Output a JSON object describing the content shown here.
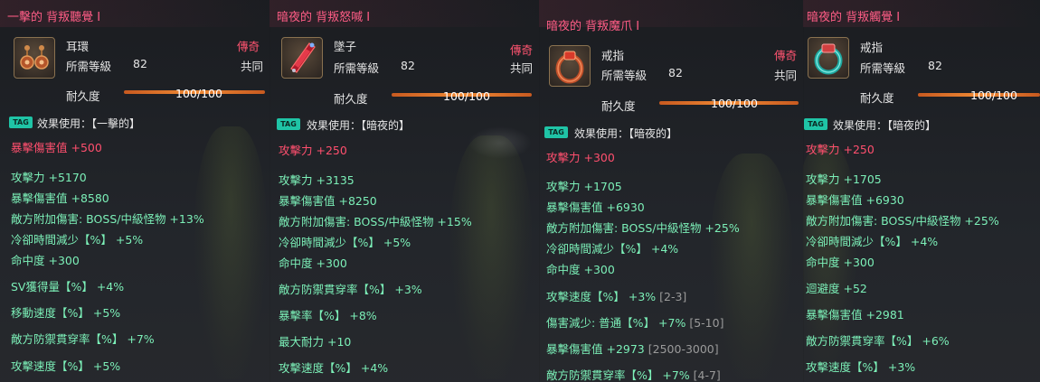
{
  "panels": [
    {
      "title": "一擊的 背叛聽覺 I",
      "type": "耳環",
      "level_label": "所需等級",
      "level": "82",
      "rarity": "傳奇",
      "shared": "共同",
      "durability_label": "耐久度",
      "durability": "100/100",
      "tag": "TAG",
      "effect": "效果使用：【一擊的】",
      "icon": "earring-icon",
      "highlight": "暴擊傷害值 +500",
      "stats": [
        {
          "name": "攻擊力 +5170"
        },
        {
          "name": "暴擊傷害值 +8580"
        },
        {
          "name": "敵方附加傷害: BOSS/中級怪物 +13%"
        },
        {
          "name": "冷卻時間減少【%】 +5%"
        },
        {
          "name": "命中度 +300"
        },
        {
          "name": "SV獲得量【%】 +4%"
        },
        {
          "name": "移動速度【%】 +5%"
        },
        {
          "name": "敵方防禦貫穿率【%】 +7%"
        },
        {
          "name": "攻擊速度【%】 +5%"
        }
      ]
    },
    {
      "title": "暗夜的 背叛怒喊 I",
      "type": "墜子",
      "level_label": "所需等級",
      "level": "82",
      "rarity": "傳奇",
      "shared": "共同",
      "durability_label": "耐久度",
      "durability": "100/100",
      "tag": "TAG",
      "effect": "效果使用：【暗夜的】",
      "icon": "pendant-icon",
      "highlight": "攻擊力 +250",
      "stats": [
        {
          "name": "攻擊力 +3135"
        },
        {
          "name": "暴擊傷害值 +8250"
        },
        {
          "name": "敵方附加傷害: BOSS/中級怪物 +15%"
        },
        {
          "name": "冷卻時間減少【%】 +5%"
        },
        {
          "name": "命中度 +300"
        },
        {
          "name": "敵方防禦貫穿率【%】 +3%"
        },
        {
          "name": "暴擊率【%】 +8%"
        },
        {
          "name": "最大耐力 +10"
        },
        {
          "name": "攻擊速度【%】 +4%"
        }
      ]
    },
    {
      "title": "暗夜的 背叛魔爪 I",
      "type": "戒指",
      "level_label": "所需等級",
      "level": "82",
      "rarity": "傳奇",
      "shared": "共同",
      "durability_label": "耐久度",
      "durability": "100/100",
      "tag": "TAG",
      "effect": "效果使用：【暗夜的】",
      "icon": "ring-icon",
      "highlight": "攻擊力 +300",
      "stats": [
        {
          "name": "攻擊力 +1705",
          "range": ""
        },
        {
          "name": "暴擊傷害值 +6930",
          "range": ""
        },
        {
          "name": "敵方附加傷害: BOSS/中級怪物 +25%",
          "range": ""
        },
        {
          "name": "冷卻時間減少【%】 +4%",
          "range": ""
        },
        {
          "name": "命中度 +300",
          "range": ""
        },
        {
          "name": "攻擊速度【%】 +3%",
          "range": "[2-3]"
        },
        {
          "name": "傷害減少: 普通【%】 +7%",
          "range": "[5-10]"
        },
        {
          "name": "暴擊傷害值 +2973",
          "range": "[2500-3000]"
        },
        {
          "name": "敵方防禦貫穿率【%】 +7%",
          "range": "[4-7]"
        }
      ]
    },
    {
      "title": "暗夜的 背叛觸覺 I",
      "type": "戒指",
      "level_label": "所需等級",
      "level": "82",
      "rarity": "傳奇",
      "shared": "共同",
      "durability_label": "耐久度",
      "durability": "100/100",
      "tag": "TAG",
      "effect": "效果使用：【暗夜的】",
      "icon": "ring-icon",
      "highlight": "攻擊力 +250",
      "stats": [
        {
          "name": "攻擊力 +1705"
        },
        {
          "name": "暴擊傷害值 +6930"
        },
        {
          "name": "敵方附加傷害: BOSS/中級怪物 +25%"
        },
        {
          "name": "冷卻時間減少【%】 +4%"
        },
        {
          "name": "命中度 +300"
        },
        {
          "name": "迴避度 +52"
        },
        {
          "name": "暴擊傷害值 +2981"
        },
        {
          "name": "敵方防禦貫穿率【%】 +6%"
        },
        {
          "name": "攻擊速度【%】 +3%"
        }
      ]
    }
  ]
}
